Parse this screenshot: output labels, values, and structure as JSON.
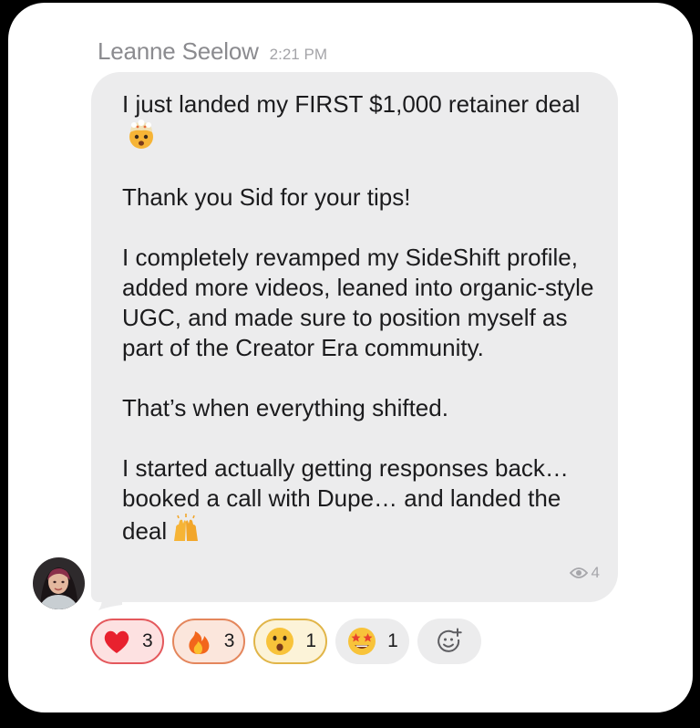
{
  "message": {
    "sender_name": "Leanne Seelow",
    "time": "2:21 PM",
    "paragraphs": [
      "I just landed my FIRST $1,000 retainer deal",
      "Thank you Sid for your tips!",
      "I completely revamped my SideShift profile, added more videos, leaned into organic-style UGC, and made sure to position myself as part of the Creator Era community.",
      "That’s when everything shifted.",
      "I started actually getting responses back… booked a call with Dupe… and landed the deal"
    ],
    "inline_emoji": [
      "exploding-head-emoji",
      "raising-hands-emoji"
    ],
    "view_count": "4"
  },
  "reactions": [
    {
      "emoji": "red-heart",
      "count": "3",
      "selected": true,
      "color": "#e4585c"
    },
    {
      "emoji": "fire",
      "count": "3",
      "selected": true,
      "color": "#e4865c"
    },
    {
      "emoji": "face-with-open-mouth",
      "count": "1",
      "selected": true,
      "color": "#e1b548"
    },
    {
      "emoji": "star-struck",
      "count": "1",
      "selected": false,
      "color": "#ececed"
    }
  ],
  "add_reaction_icon": "add-reaction-icon",
  "colors": {
    "bubble": "#ececed",
    "card": "#ffffff",
    "text": "#1b1b1d",
    "muted": "#8b8b8f"
  }
}
